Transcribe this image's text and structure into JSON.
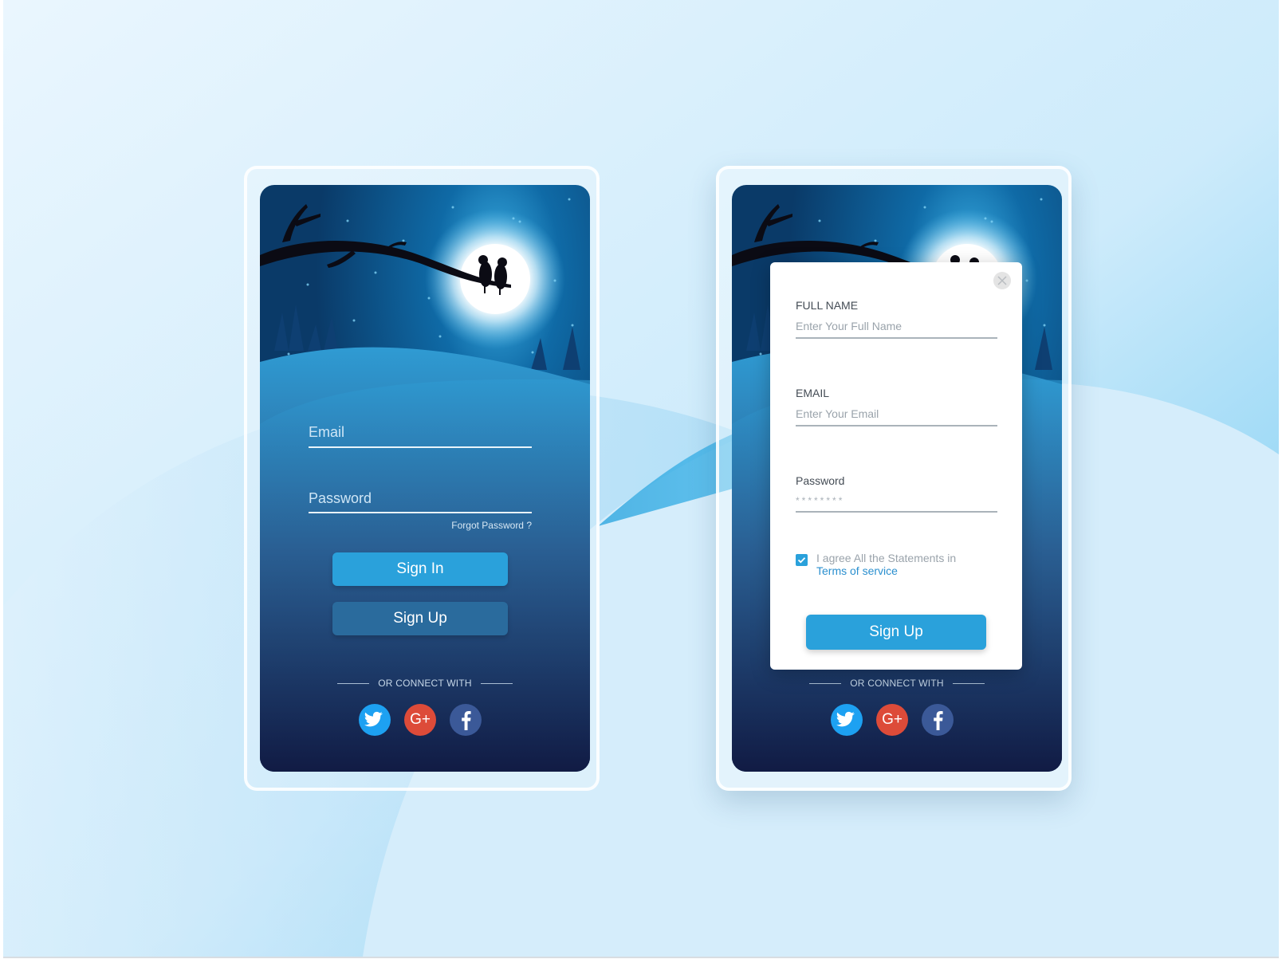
{
  "login_card": {
    "email_label": "Email",
    "password_label": "Password",
    "forgot_password": "Forgot Password ?",
    "sign_in": "Sign In",
    "sign_up": "Sign Up",
    "connect_text": "OR CONNECT WITH",
    "socials": [
      "twitter-icon",
      "google-plus-icon",
      "facebook-icon"
    ]
  },
  "signup_card": {
    "full_name_label": "FULL NAME",
    "full_name_placeholder": "Enter Your Full Name",
    "email_label": "EMAIL",
    "email_placeholder": "Enter Your Email",
    "password_label": "Password",
    "password_value": "********",
    "agree_text": "I agree All the Statements in",
    "terms_link": "Terms of service",
    "terms_checked": true,
    "sign_up": "Sign Up",
    "connect_text": "OR CONNECT WITH",
    "socials": [
      "twitter-icon",
      "google-plus-icon",
      "facebook-icon"
    ]
  },
  "social_glyphs": {
    "google_plus": "G+"
  },
  "colors": {
    "accent": "#2aa1db",
    "secondary_button": "#2a6b9d",
    "twitter": "#1da1f2",
    "google_plus": "#dd4b39",
    "facebook": "#3b5998",
    "night_top": "#0a4a7c",
    "night_bottom": "#121c45"
  }
}
